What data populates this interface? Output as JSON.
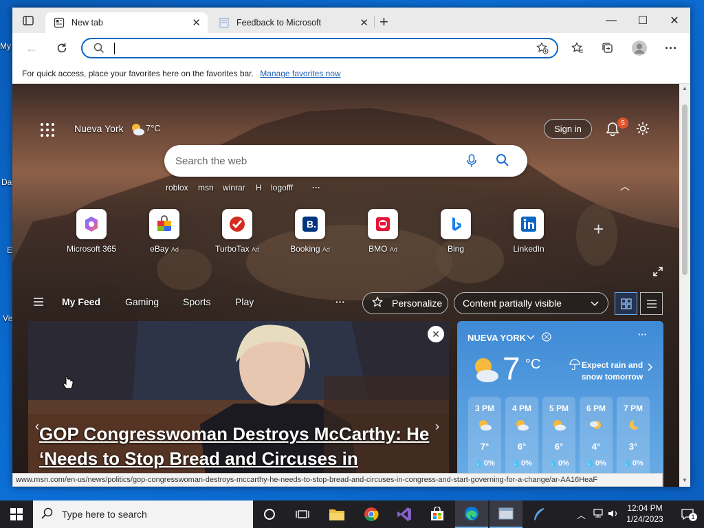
{
  "desktop": {
    "labels": [
      "My",
      "Da",
      "E",
      "Vis"
    ]
  },
  "browser": {
    "tabs": [
      {
        "title": "New tab",
        "active": true
      },
      {
        "title": "Feedback to Microsoft",
        "active": false
      }
    ],
    "new_tab_symbol": "+",
    "window_buttons": {
      "minimize": "—",
      "maximize": "☐",
      "close": "✕"
    },
    "address_value": "",
    "favorites_bar": {
      "text": "For quick access, place your favorites here on the favorites bar.",
      "link": "Manage favorites now"
    }
  },
  "msn": {
    "location": "Nueva York",
    "temperature": "7°C",
    "sign_in": "Sign in",
    "notification_count": "5",
    "search_placeholder": "Search the web",
    "recent_searches": [
      "roblox",
      "msn",
      "winrar",
      "H",
      "logofff"
    ],
    "recent_more": "···",
    "quick_links": [
      {
        "label": "Microsoft 365",
        "ad": "",
        "icon": "microsoft-365-icon",
        "color": "#7b5cff"
      },
      {
        "label": "eBay",
        "ad": "Ad",
        "icon": "ebay-icon",
        "color": "#e53238"
      },
      {
        "label": "TurboTax",
        "ad": "Ad",
        "icon": "turbotax-icon",
        "color": "#d52b1e"
      },
      {
        "label": "Booking",
        "ad": "Ad",
        "icon": "booking-icon",
        "color": "#003580"
      },
      {
        "label": "BMO",
        "ad": "Ad",
        "icon": "bmo-icon",
        "color": "#0079c1"
      },
      {
        "label": "Bing",
        "ad": "",
        "icon": "bing-icon",
        "color": "#0a84ff"
      },
      {
        "label": "LinkedIn",
        "ad": "",
        "icon": "linkedin-icon",
        "color": "#0a66c2"
      }
    ],
    "feed_tabs": [
      "My Feed",
      "Gaming",
      "Sports",
      "Play"
    ],
    "feed_more": "···",
    "personalize": "Personalize",
    "content_visibility": "Content partially visible",
    "news": {
      "headline": "GOP Congresswoman Destroys McCarthy: He ‘Needs to Stop Bread and Circuses in Congress and Start Governing for a Change’"
    },
    "weather": {
      "city": "NUEVA YORK",
      "temp": "7",
      "unit": "°C",
      "forecast_text": "Expect rain and snow tomorrow",
      "hours": [
        {
          "time": "3 PM",
          "temp": "7°",
          "precip": "0%"
        },
        {
          "time": "4 PM",
          "temp": "6°",
          "precip": "0%"
        },
        {
          "time": "5 PM",
          "temp": "6°",
          "precip": "0%"
        },
        {
          "time": "6 PM",
          "temp": "4°",
          "precip": "0%"
        },
        {
          "time": "7 PM",
          "temp": "3°",
          "precip": "0%"
        }
      ]
    }
  },
  "status_url": "www.msn.com/en-us/news/politics/gop-congresswoman-destroys-mccarthy-he-needs-to-stop-bread-and-circuses-in-congress-and-start-governing-for-a-change/ar-AA16HeaF",
  "taskbar": {
    "search_placeholder": "Type here to search",
    "time": "12:04 PM",
    "date": "1/24/2023",
    "notification_count": "1"
  }
}
